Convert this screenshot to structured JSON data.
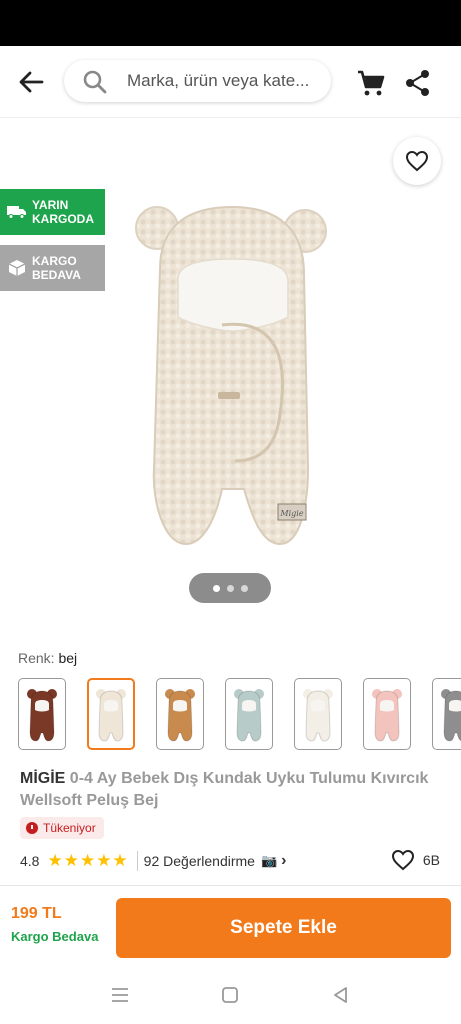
{
  "header": {
    "search_placeholder": "Marka, ürün veya kate...",
    "icons": [
      "back-arrow-icon",
      "search-icon",
      "cart-icon",
      "share-icon"
    ]
  },
  "gallery": {
    "badges": [
      {
        "label": "YARIN KARGODA",
        "line1": "YARIN",
        "line2": "KARGODA",
        "color": "#1ea44c",
        "icon": "truck-icon"
      },
      {
        "label": "KARGO BEDAVA",
        "line1": "KARGO",
        "line2": "BEDAVA",
        "color": "#a6a6a6",
        "icon": "box-icon"
      }
    ],
    "page_count": 3,
    "active_page": 1
  },
  "variants": {
    "color_label": "Renk:",
    "color_value": "bej",
    "swatches": [
      {
        "color": "#7a3826",
        "selected": false
      },
      {
        "color": "#efe6d8",
        "selected": true
      },
      {
        "color": "#c98a4e",
        "selected": false
      },
      {
        "color": "#b7cbc8",
        "selected": false
      },
      {
        "color": "#f3efe6",
        "selected": false
      },
      {
        "color": "#f3c3bd",
        "selected": false
      },
      {
        "color": "#8e8e8e",
        "selected": false
      }
    ]
  },
  "product": {
    "brand": "MİGİE",
    "name": " 0-4 Ay Bebek Dış Kundak Uyku Tulumu Kıvırcık Wellsoft Peluş Bej",
    "stock_status": "Tükeniyor",
    "rating": "4.8",
    "stars": 5,
    "review_count": "92 Değerlendirme",
    "likes": "6B"
  },
  "bottom_bar": {
    "price": "199 TL",
    "shipping": "Kargo Bedava",
    "add_to_cart": "Sepete Ekle"
  },
  "colors": {
    "accent": "#f27a1a",
    "green": "#1ea44c",
    "star": "#ffc000",
    "stock_red": "#c51d1d"
  }
}
